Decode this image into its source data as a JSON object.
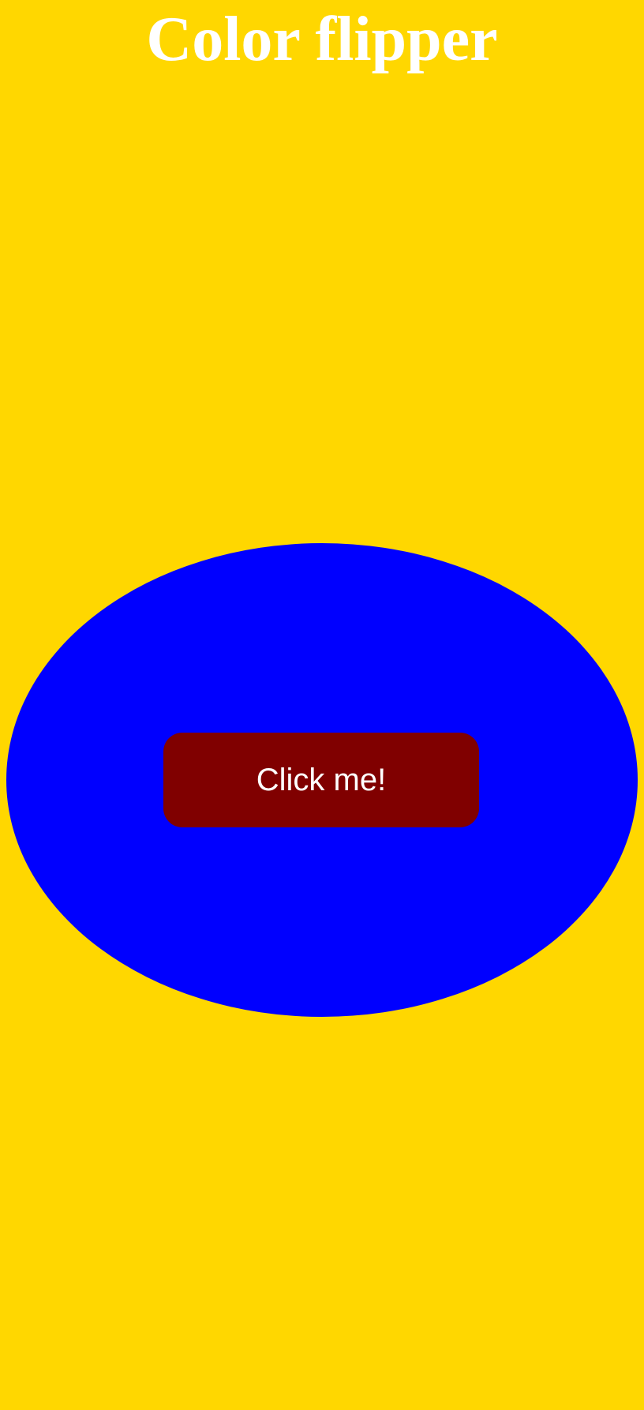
{
  "page": {
    "title": "Color flipper"
  },
  "button": {
    "label": "Click me!"
  },
  "colors": {
    "background": "#FFD700",
    "ellipse": "#0000FF",
    "button": "#800000",
    "text": "#FFFFFF"
  }
}
